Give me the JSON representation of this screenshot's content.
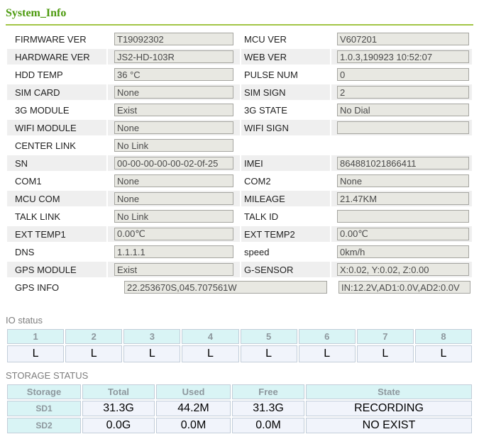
{
  "page": {
    "title": "System_Info"
  },
  "colors": {
    "title_green": "#4c9a0e",
    "divider_green": "#a2c546",
    "row_stripe": "#efefef",
    "input_bg": "#e8e8e2",
    "input_border": "#a5a5a0",
    "table_header_bg": "#d9f4f5",
    "table_cell_bg": "#f1f4fb",
    "table_border": "#c2cdd9"
  },
  "system_info": {
    "rows": [
      {
        "label_left": "FIRMWARE VER",
        "value_left": "T19092302",
        "label_right": "MCU VER",
        "value_right": "V607201"
      },
      {
        "label_left": "HARDWARE VER",
        "value_left": "JS2-HD-103R",
        "label_right": "WEB VER",
        "value_right": "1.0.3,190923 10:52:07"
      },
      {
        "label_left": "HDD TEMP",
        "value_left": "36 °C",
        "label_right": "PULSE NUM",
        "value_right": "0"
      },
      {
        "label_left": "SIM CARD",
        "value_left": "None",
        "label_right": "SIM SIGN",
        "value_right": "2"
      },
      {
        "label_left": "3G MODULE",
        "value_left": "Exist",
        "label_right": "3G STATE",
        "value_right": "No Dial"
      },
      {
        "label_left": "WIFI MODULE",
        "value_left": "None",
        "label_right": "WIFI SIGN",
        "value_right": ""
      },
      {
        "label_left": "CENTER LINK",
        "value_left": "No Link",
        "label_right": "",
        "input_right": false
      },
      {
        "label_left": "SN",
        "value_left": "00-00-00-00-00-02-0f-25",
        "label_right": "IMEI",
        "value_right": "864881021866411"
      },
      {
        "label_left": "COM1",
        "value_left": "None",
        "label_right": "COM2",
        "value_right": "None"
      },
      {
        "label_left": "MCU COM",
        "value_left": "None",
        "label_right": "MILEAGE",
        "value_right": "21.47KM"
      },
      {
        "label_left": "TALK LINK",
        "value_left": "No Link",
        "label_right": "TALK ID",
        "value_right": ""
      },
      {
        "label_left": "EXT TEMP1",
        "value_left": "0.00℃",
        "label_right": "EXT TEMP2",
        "value_right": "0.00℃"
      },
      {
        "label_left": "DNS",
        "value_left": "1.1.1.1",
        "label_right": "speed",
        "value_right": "0km/h"
      },
      {
        "label_left": "GPS MODULE",
        "value_left": "Exist",
        "label_right": "G-SENSOR",
        "value_right": "X:0.02, Y:0.02, Z:0.00"
      },
      {
        "label_left": "GPS INFO",
        "value_left": "22.253670S,045.707561W",
        "wide": true,
        "value_right": "IN:12.2V,AD1:0.0V,AD2:0.0V"
      }
    ]
  },
  "io_status": {
    "label": "IO status",
    "channels": [
      "1",
      "2",
      "3",
      "4",
      "5",
      "6",
      "7",
      "8"
    ],
    "values": [
      "L",
      "L",
      "L",
      "L",
      "L",
      "L",
      "L",
      "L"
    ]
  },
  "storage": {
    "label": "STORAGE STATUS",
    "headers": [
      "Storage",
      "Total",
      "Used",
      "Free",
      "State"
    ],
    "rows": [
      {
        "name": "SD1",
        "total": "31.3G",
        "used": "44.2M",
        "free": "31.3G",
        "state": "RECORDING"
      },
      {
        "name": "SD2",
        "total": "0.0G",
        "used": "0.0M",
        "free": "0.0M",
        "state": "NO EXIST"
      }
    ]
  }
}
